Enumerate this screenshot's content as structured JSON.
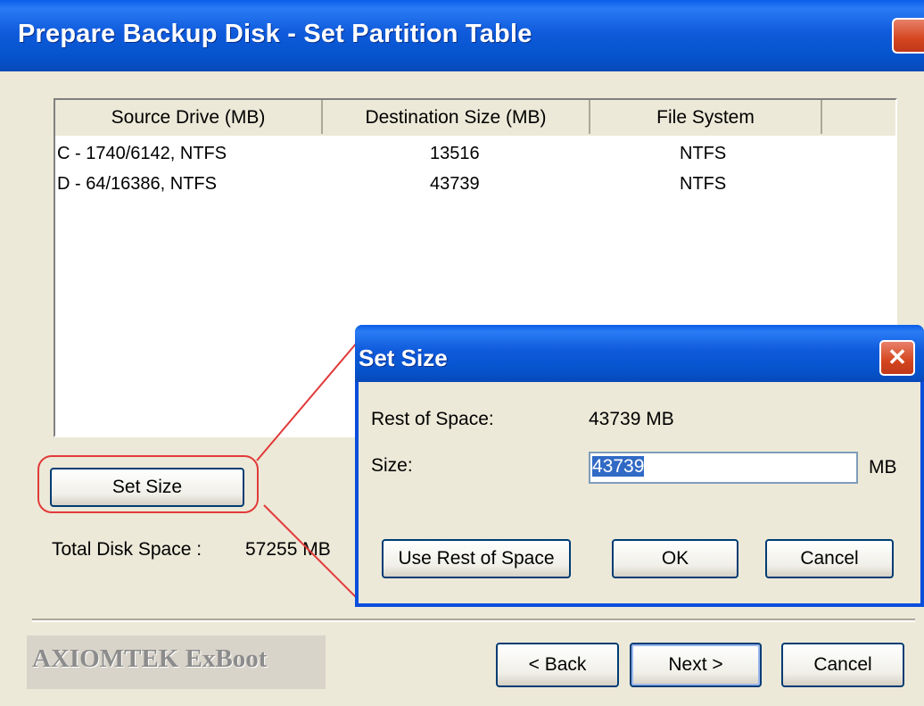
{
  "window": {
    "title": "Prepare Backup Disk - Set Partition Table"
  },
  "list": {
    "columns": [
      "Source Drive (MB)",
      "Destination Size (MB)",
      "File System"
    ],
    "rows": [
      {
        "source": "C - 1740/6142, NTFS",
        "dest": "13516",
        "fs": "NTFS"
      },
      {
        "source": "D - 64/16386, NTFS",
        "dest": "43739",
        "fs": "NTFS"
      }
    ]
  },
  "main": {
    "set_size_label": "Set Size",
    "total_label": "Total Disk Space :",
    "total_value": "57255 MB",
    "brand": "AXIOMTEK ExBoot",
    "back_label": "< Back",
    "next_label": "Next >",
    "cancel_label": "Cancel"
  },
  "dialog": {
    "title": "Set Size",
    "rest_label": "Rest of Space:",
    "rest_value": "43739 MB",
    "size_label": "Size:",
    "size_value": "43739",
    "size_unit": "MB",
    "use_rest_label": "Use Rest of Space",
    "ok_label": "OK",
    "cancel_label": "Cancel"
  },
  "colors": {
    "title_blue": "#0553CC",
    "close_red": "#D4451E",
    "highlight_red": "#E23A3A"
  },
  "icons": {
    "close": "close-icon"
  }
}
